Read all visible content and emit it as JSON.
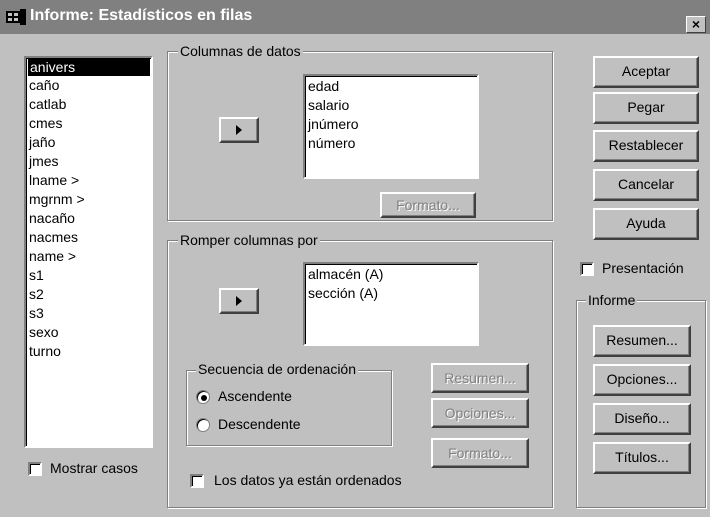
{
  "window": {
    "title": "Informe: Estadísticos en filas",
    "close_glyph": "×"
  },
  "variables": {
    "items": [
      "anivers",
      "caño",
      "catlab",
      "cmes",
      "jaño",
      "jmes",
      "lname  >",
      "mgrnm  >",
      "nacaño",
      "nacmes",
      "name  >",
      "s1",
      "s2",
      "s3",
      "sexo",
      "turno"
    ],
    "selected": "anivers"
  },
  "show_cases": {
    "label": "Mostrar casos",
    "checked": false
  },
  "data_columns": {
    "label": "Columnas de datos",
    "items": [
      "edad",
      "salario",
      "jnúmero",
      "número"
    ],
    "format_button": "Formato..."
  },
  "break_columns": {
    "label": "Romper columnas por",
    "items": [
      "almacén (A)",
      "sección (A)"
    ],
    "sort": {
      "label": "Secuencia de ordenación",
      "ascending": "Ascendente",
      "descending": "Descendente",
      "selected": "ascending"
    },
    "buttons": {
      "summary": "Resumen...",
      "options": "Opciones...",
      "format": "Formato..."
    },
    "sorted_checkbox": {
      "label": "Los datos ya están ordenados",
      "checked": false
    }
  },
  "buttons": {
    "ok": "Aceptar",
    "paste": "Pegar",
    "reset": "Restablecer",
    "cancel": "Cancelar",
    "help": "Ayuda"
  },
  "presentation": {
    "label": "Presentación",
    "checked": false
  },
  "report": {
    "label": "Informe",
    "summary": "Resumen...",
    "options": "Opciones...",
    "layout": "Diseño...",
    "titles": "Títulos..."
  },
  "icons": {
    "app": "table-icon",
    "move_right": "right-arrow-icon"
  }
}
